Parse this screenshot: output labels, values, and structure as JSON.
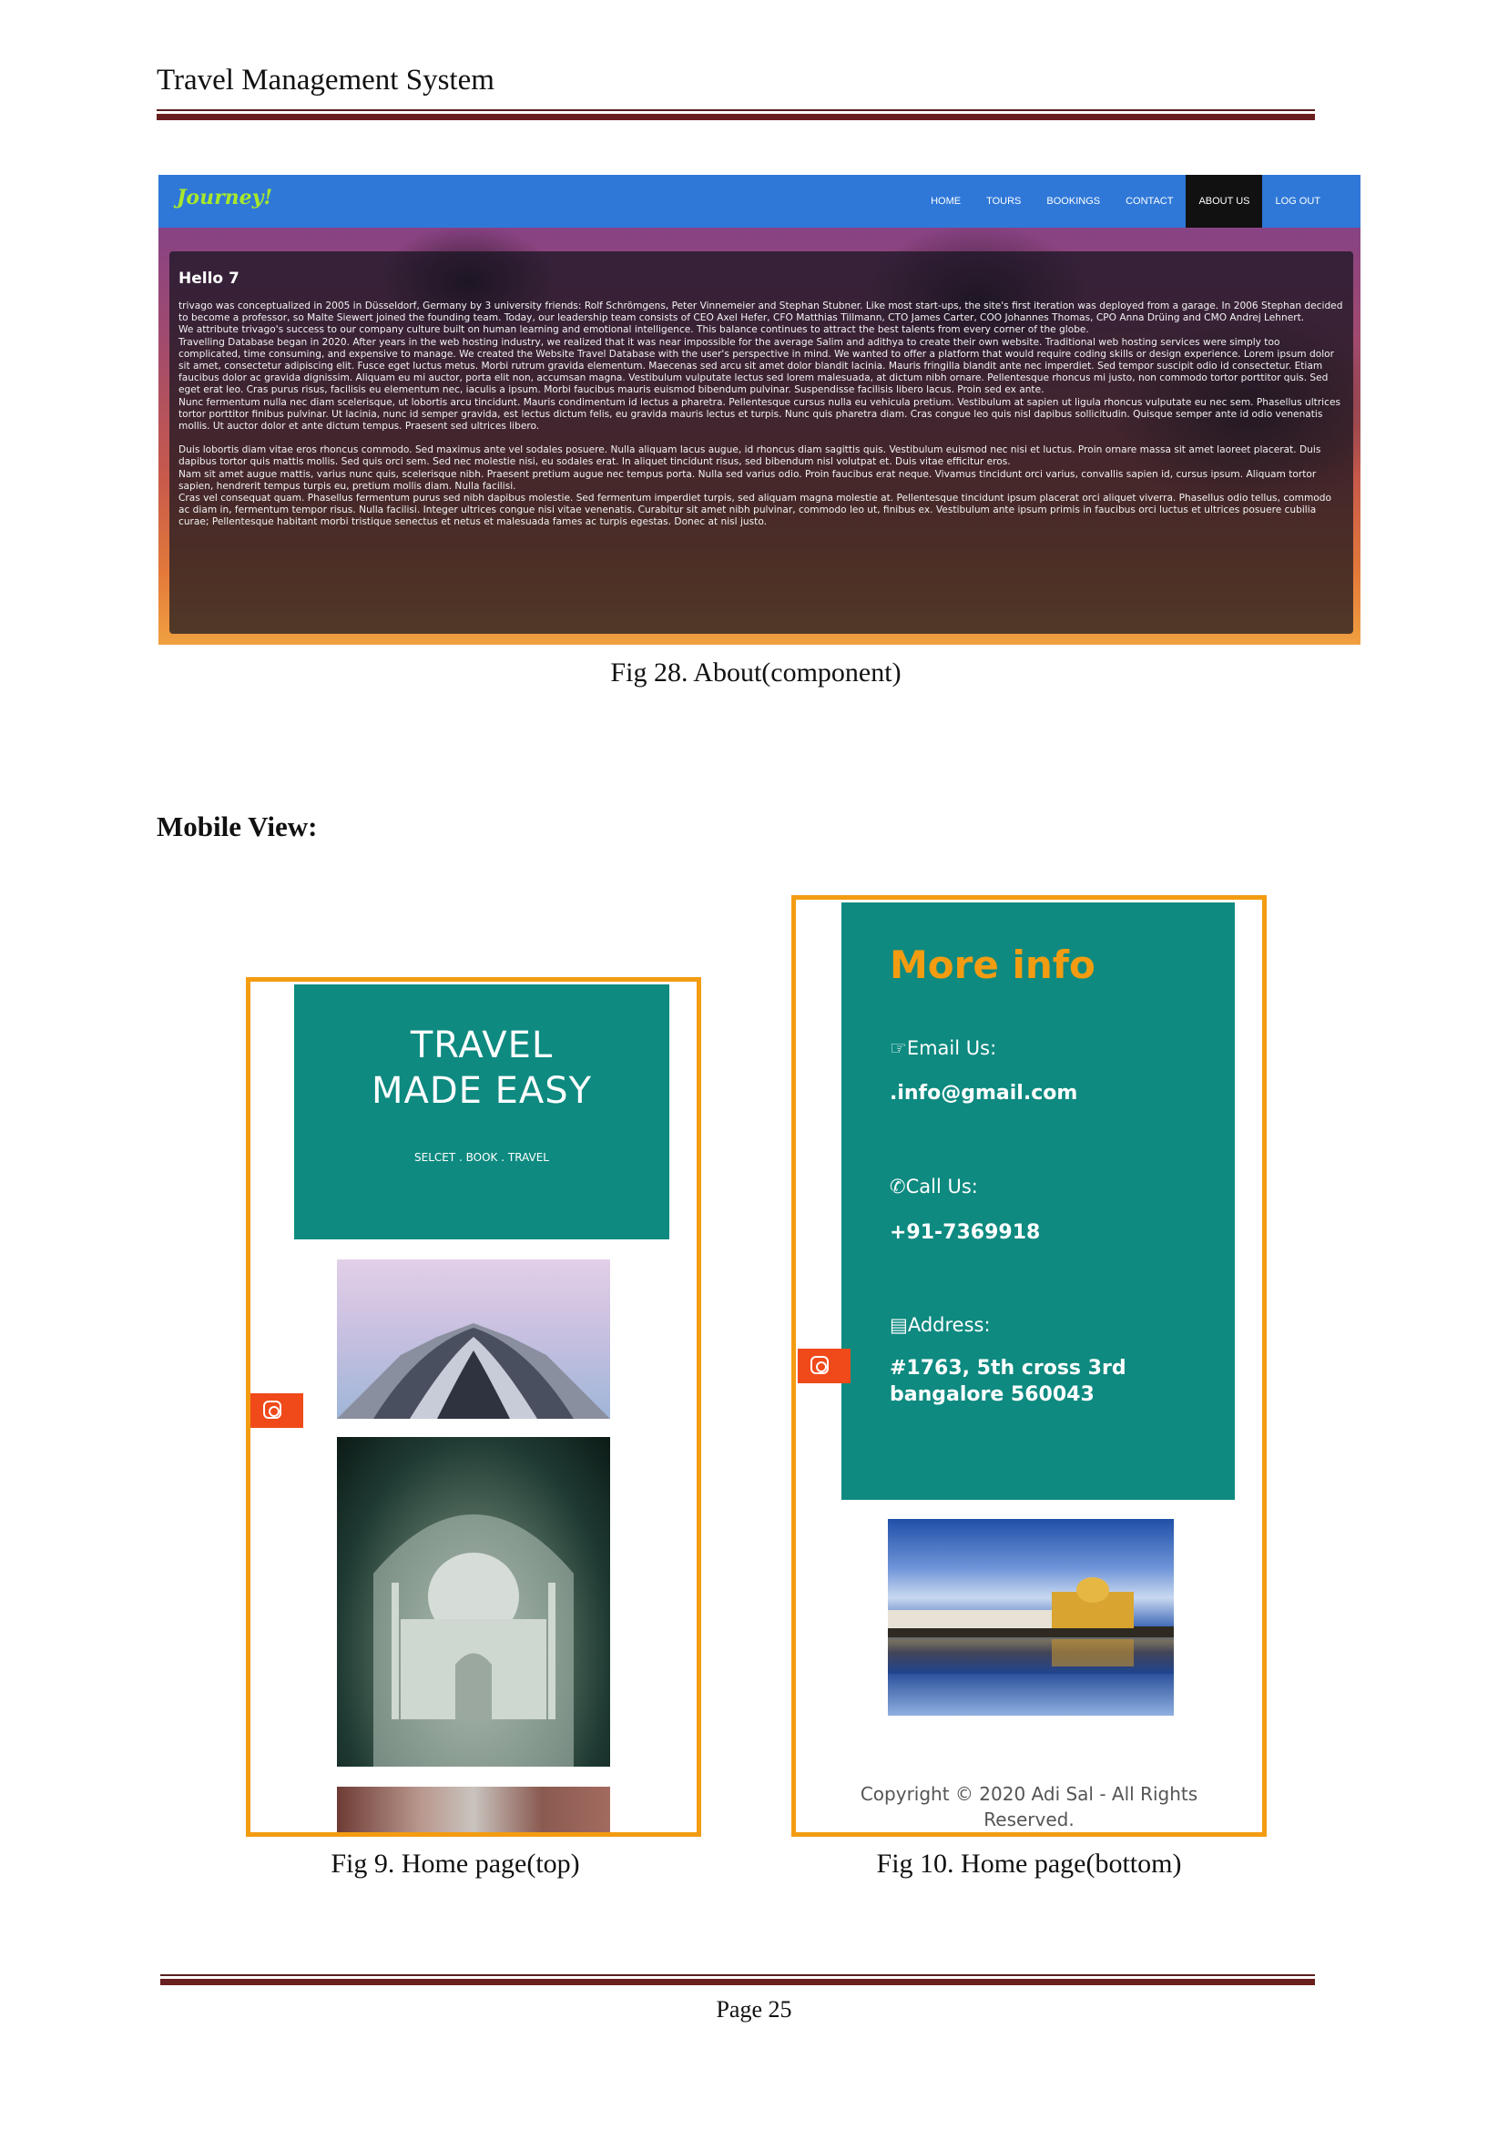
{
  "header": {
    "title": "Travel Management System"
  },
  "desktop": {
    "brand": "Journey!",
    "menu": [
      "HOME",
      "TOURS",
      "BOOKINGS",
      "CONTACT",
      "ABOUT US",
      "LOG OUT"
    ],
    "active_menu": "ABOUT US",
    "greeting": "Hello 7",
    "paragraphs": [
      "trivago was conceptualized in 2005 in Düsseldorf, Germany by 3 university friends: Rolf Schrömgens, Peter Vinnemeier and Stephan Stubner. Like most start-ups, the site's first iteration was deployed from a garage. In 2006 Stephan decided to become a professor, so Malte Siewert joined the founding team. Today, our leadership team consists of CEO Axel Hefer, CFO Matthias Tillmann, CTO James Carter, COO Johannes Thomas, CPO Anna Drüing and CMO Andrej Lehnert.",
      "We attribute trivago's success to our company culture built on human learning and emotional intelligence. This balance continues to attract the best talents from every corner of the globe.",
      "Travelling Database began in 2020. After years in the web hosting industry, we realized that it was near impossible for the average Salim and adithya to create their own website. Traditional web hosting services were simply too complicated, time consuming, and expensive to manage. We created the Website Travel Database with the user's perspective in mind. We wanted to offer a platform that would require coding skills or design experience. Lorem ipsum dolor sit amet, consectetur adipiscing elit. Fusce eget luctus metus. Morbi rutrum gravida elementum. Maecenas sed arcu sit amet dolor blandit lacinia. Mauris fringilla blandit ante nec imperdiet. Sed tempor suscipit odio id consectetur. Etiam faucibus dolor ac gravida dignissim. Aliquam eu mi auctor, porta elit non, accumsan magna. Vestibulum vulputate lectus sed lorem malesuada, at dictum nibh ornare. Pellentesque rhoncus mi justo, non commodo tortor porttitor quis. Sed eget erat leo. Cras purus risus, facilisis eu elementum nec, iaculis a ipsum. Morbi faucibus mauris euismod bibendum pulvinar. Suspendisse facilisis libero lacus. Proin sed ex ante.",
      "Nunc fermentum nulla nec diam scelerisque, ut lobortis arcu tincidunt. Mauris condimentum id lectus a pharetra. Pellentesque cursus nulla eu vehicula pretium. Vestibulum at sapien ut ligula rhoncus vulputate eu nec sem. Phasellus ultrices tortor porttitor finibus pulvinar. Ut lacinia, nunc id semper gravida, est lectus dictum felis, eu gravida mauris lectus et turpis. Nunc quis pharetra diam. Cras congue leo quis nisl dapibus sollicitudin. Quisque semper ante id odio venenatis mollis. Ut auctor dolor et ante dictum tempus. Praesent sed ultrices libero.",
      "Duis lobortis diam vitae eros rhoncus commodo. Sed maximus ante vel sodales posuere. Nulla aliquam lacus augue, id rhoncus diam sagittis quis. Vestibulum euismod nec nisi et luctus. Proin ornare massa sit amet laoreet placerat. Duis dapibus tortor quis mattis mollis. Sed quis orci sem. Sed nec molestie nisi, eu sodales erat. In aliquet tincidunt risus, sed bibendum nisl volutpat et. Duis vitae efficitur eros.",
      "Nam sit amet augue mattis, varius nunc quis, scelerisque nibh. Praesent pretium augue nec tempus porta. Nulla sed varius odio. Proin faucibus erat neque. Vivamus tincidunt orci varius, convallis sapien id, cursus ipsum. Aliquam tortor sapien, hendrerit tempus turpis eu, pretium mollis diam. Nulla facilisi.",
      "Cras vel consequat quam. Phasellus fermentum purus sed nibh dapibus molestie. Sed fermentum imperdiet turpis, sed aliquam magna molestie at. Pellentesque tincidunt ipsum placerat orci aliquet viverra. Phasellus odio tellus, commodo ac diam in, fermentum tempor risus. Nulla facilisi. Integer ultrices congue nisi vitae venenatis. Curabitur sit amet nibh pulvinar, commodo leo ut, finibus ex. Vestibulum ante ipsum primis in faucibus orci luctus et ultrices posuere cubilia curae; Pellentesque habitant morbi tristique senectus et netus et malesuada fames ac turpis egestas. Donec at nisl justo."
    ],
    "background_colors": {
      "nav": "#2f78d8",
      "brand": "#a8e82b"
    }
  },
  "captions": {
    "fig28": "Fig 28. About(component)",
    "fig9": "Fig 9. Home page(top)",
    "fig10": "Fig 10. Home page(bottom)"
  },
  "section_label": "Mobile View:",
  "mobile_top": {
    "hero_line1": "TRAVEL",
    "hero_line2": "MADE EASY",
    "hero_sub": "SELCET . BOOK . TRAVEL",
    "accent": "#0e8a80",
    "frame_color": "#f39c12"
  },
  "mobile_bottom": {
    "heading": "More info",
    "email_label": "Email Us:",
    "email_value": ".info@gmail.com",
    "call_label": "Call Us:",
    "call_value": "+91-7369918",
    "address_label": "Address:",
    "address_line1": "#1763, 5th cross 3rd",
    "address_line2": "bangalore 560043",
    "copyright_line1": "Copyright © 2020 Adi Sal - All Rights",
    "copyright_line2": "Reserved."
  },
  "footer": {
    "page": "Page 25"
  }
}
